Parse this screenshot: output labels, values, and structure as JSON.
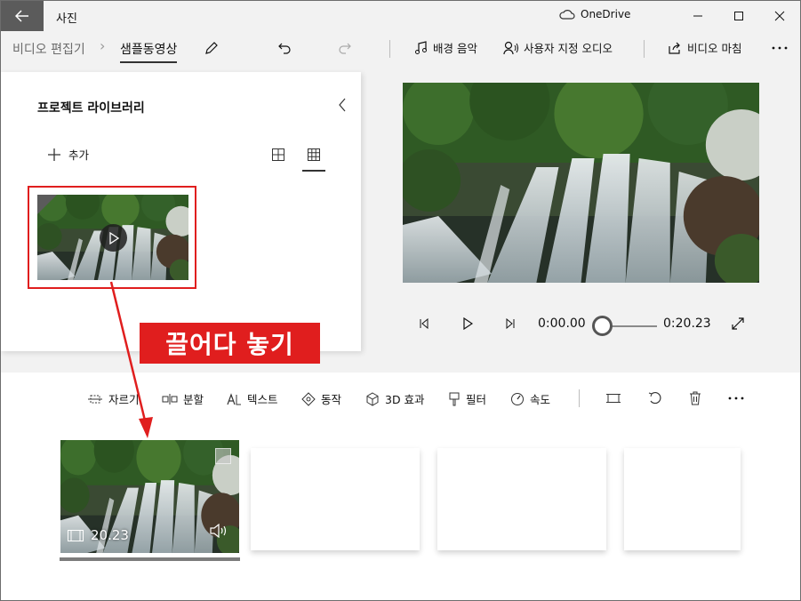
{
  "window": {
    "app_title": "사진",
    "cloud_label": "OneDrive"
  },
  "toolbar": {
    "breadcrumb_root": "비디오 편집기",
    "breadcrumb_current": "샘플동영상",
    "background_music": "배경 음악",
    "custom_audio": "사용자 지정 오디오",
    "finish_video": "비디오 마침"
  },
  "library": {
    "title": "프로젝트 라이브러리",
    "add_label": "추가"
  },
  "player": {
    "current_time": "0:00.00",
    "total_time": "0:20.23",
    "progress": 0
  },
  "storyboard": {
    "trim": "자르기",
    "split": "분할",
    "text": "텍스트",
    "motion": "동작",
    "effects_3d": "3D 효과",
    "filters": "필터",
    "speed": "속도",
    "clip_duration": "20.23"
  },
  "annotation": {
    "label": "끌어다 놓기",
    "color": "#e01e1e"
  }
}
